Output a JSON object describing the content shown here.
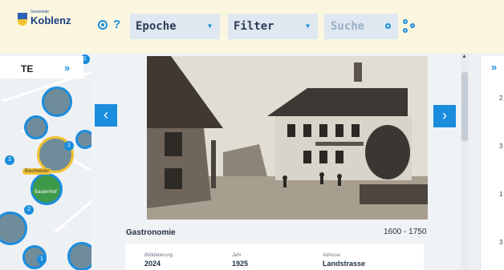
{
  "header": {
    "municipality_label": "Gemeinde",
    "city": "Koblenz",
    "help": "?",
    "epoch_dropdown": "Epoche",
    "filter_dropdown": "Filter",
    "search_placeholder": "Suche"
  },
  "left_panel": {
    "title": "TE",
    "expand": "»",
    "bubble_labels": [
      "Baumeister",
      "Bauernhof"
    ],
    "badges": [
      "1",
      "2",
      "1",
      "3",
      "1"
    ]
  },
  "right_panel": {
    "expand": "»",
    "numbers": [
      "2",
      "3",
      "1",
      "3"
    ]
  },
  "modal": {
    "prev": "‹",
    "next": "›",
    "category": "Gastronomie",
    "period": "1600 - 1750",
    "details": [
      {
        "label": "Bilddatierung",
        "value": "2024"
      },
      {
        "label": "Jahr",
        "value": "1925"
      },
      {
        "label": "Adresse",
        "value": "Landstrasse"
      }
    ]
  },
  "colors": {
    "accent": "#1a8ddd",
    "header_bg": "#fbf6df",
    "dropdown_bg": "#dfe7f0"
  }
}
